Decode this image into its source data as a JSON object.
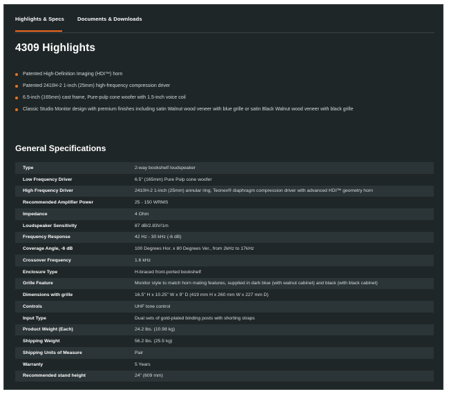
{
  "tabs": [
    {
      "label": "Highlights & Specs",
      "active": true
    },
    {
      "label": "Documents & Downloads",
      "active": false
    }
  ],
  "title": "4309 Highlights",
  "highlights": [
    "Patented High-Definition Imaging (HDI™) horn",
    "Patented 2410H-2 1-inch (25mm) high-frequency compression driver",
    "6.5-inch (165mm) cast frame, Pure-pulp cone woofer with 1.5-inch voice coil",
    "Classic Studio Monitor design with premium finishes including satin Walnut wood veneer with blue grille or satin Black Walnut wood veneer with black grille"
  ],
  "specs_title": "General Specifications",
  "specs": [
    {
      "key": "Type",
      "value": "2-way bookshelf loudspeaker"
    },
    {
      "key": "Low Frequency Driver",
      "value": "6.5\" (165mm) Pure Pulp cone woofer"
    },
    {
      "key": "High Frequency Driver",
      "value": "2410H-2 1-inch (25mm) annular ring, Teonex® diaphragm compression driver with advanced HDI™ geometry horn"
    },
    {
      "key": "Recommended Amplifier Power",
      "value": "25 - 150 WRMS"
    },
    {
      "key": "Impedance",
      "value": "4 Ohm"
    },
    {
      "key": "Loudspeaker Sensitivity",
      "value": "87 dB/2.83V/1m"
    },
    {
      "key": "Frequency Response",
      "value": "42 Hz - 30 kHz (-6 dB)"
    },
    {
      "key": "Coverage Angle, -6 dB",
      "value": "100 Degrees Hor. x 80 Degrees Ver., from 2kHz to 17kHz"
    },
    {
      "key": "Crossover Frequency",
      "value": "1.6 kHz"
    },
    {
      "key": "Enclosure Type",
      "value": "H-braced front-ported bookshelf"
    },
    {
      "key": "Grille Feature",
      "value": "Monitor style to match horn mating features, supplied in dark blue (with walnut cabinet) and black (with black cabinet)"
    },
    {
      "key": "Dimensions with grille",
      "value": "16.5\" H x 10.25\" W x 9\" D (419 mm H x 260 mm W x 227 mm D)"
    },
    {
      "key": "Controls",
      "value": "UHF tone control"
    },
    {
      "key": "Input Type",
      "value": "Dual sets of gold-plated binding posts with shorting straps"
    },
    {
      "key": "Product Weight (Each)",
      "value": "24.2 lbs. (10.98 kg)"
    },
    {
      "key": "Shipping Weight",
      "value": "56.2 lbs. (25.5 kg)"
    },
    {
      "key": "Shipping Units of Measure",
      "value": "Pair"
    },
    {
      "key": "Warranty",
      "value": "5 Years"
    },
    {
      "key": "Recommended stand height",
      "value": "24\" (609 mm)"
    }
  ],
  "colors": {
    "background": "#1f2628",
    "row_stripe": "#2b3436",
    "accent": "#f26a21",
    "text": "#ffffff"
  }
}
